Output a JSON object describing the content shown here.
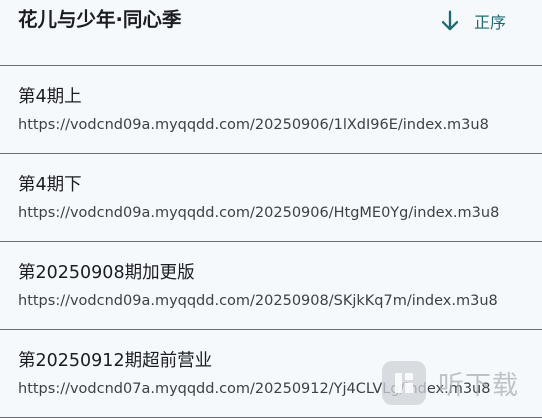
{
  "header": {
    "title": "花儿与少年·同心季",
    "sort_label": "正序"
  },
  "episodes": [
    {
      "title": "第4期上",
      "url": "https://vodcnd09a.myqqdd.com/20250906/1lXdI96E/index.m3u8"
    },
    {
      "title": "第4期下",
      "url": "https://vodcnd09a.myqqdd.com/20250906/HtgME0Yg/index.m3u8"
    },
    {
      "title": "第20250908期加更版",
      "url": "https://vodcnd09a.myqqdd.com/20250908/SKjkKq7m/index.m3u8"
    },
    {
      "title": "第20250912期超前营业",
      "url": "https://vodcnd07a.myqqdd.com/20250912/Yj4CLVLg/index.m3u8"
    }
  ],
  "watermark": {
    "text": "听下载"
  },
  "colors": {
    "background": "#f6f9fc",
    "accent": "#1f6b72",
    "divider": "#6d7177"
  }
}
